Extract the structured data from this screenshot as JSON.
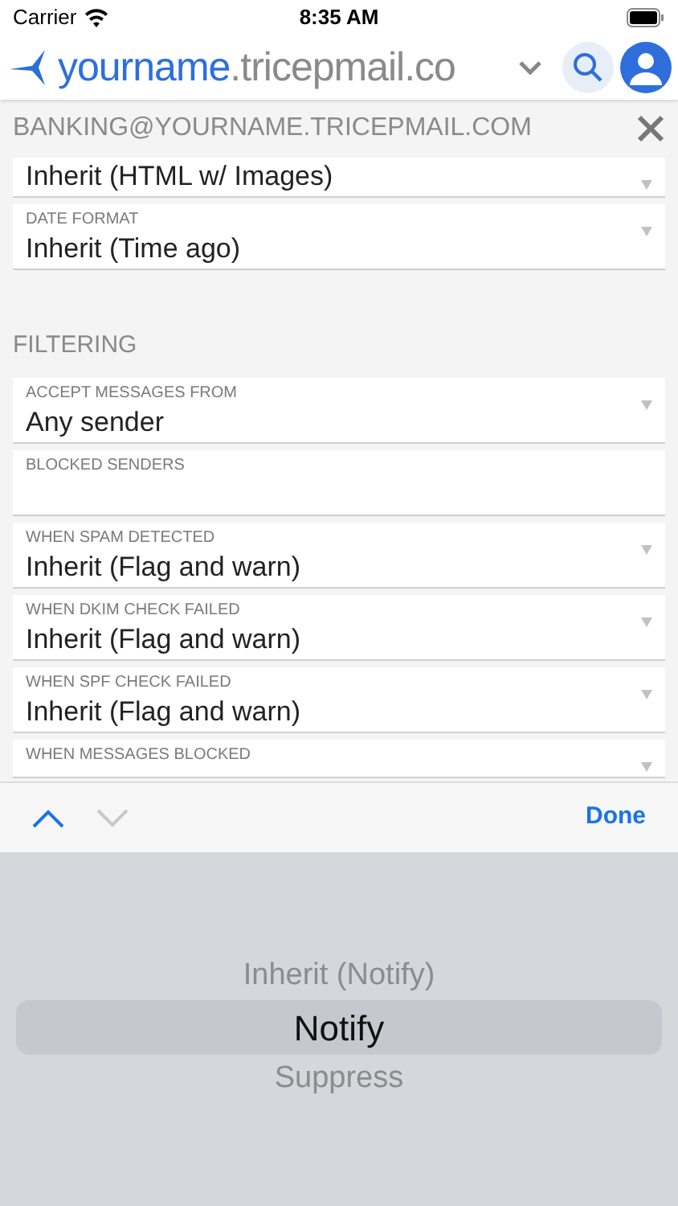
{
  "status_bar": {
    "carrier": "Carrier",
    "time": "8:35 AM"
  },
  "header": {
    "domain_user": "yourname",
    "domain_rest": ".tricepmail.co"
  },
  "account": {
    "title": "BANKING@YOURNAME.TRICEPMAIL.COM"
  },
  "sections": [
    {
      "fields": [
        {
          "kind": "select",
          "value": "Inherit (HTML w/ Images)"
        },
        {
          "kind": "select",
          "label": "DATE FORMAT",
          "value": "Inherit (Time ago)"
        }
      ]
    },
    {
      "title": "FILTERING",
      "fields": [
        {
          "kind": "select",
          "label": "ACCEPT MESSAGES FROM",
          "value": "Any sender"
        },
        {
          "kind": "text",
          "label": "BLOCKED SENDERS"
        },
        {
          "kind": "select",
          "label": "WHEN SPAM DETECTED",
          "value": "Inherit (Flag and warn)"
        },
        {
          "kind": "select",
          "label": "WHEN DKIM CHECK FAILED",
          "value": "Inherit (Flag and warn)"
        },
        {
          "kind": "select",
          "label": "WHEN SPF CHECK FAILED",
          "value": "Inherit (Flag and warn)"
        },
        {
          "kind": "select",
          "label": "WHEN MESSAGES BLOCKED"
        }
      ]
    }
  ],
  "toolbar": {
    "previous_disabled": false,
    "next_disabled": true,
    "done": "Done"
  },
  "picker": [
    {
      "label": "Inherit (Notify)",
      "selected": false
    },
    {
      "label": "Notify",
      "selected": true
    },
    {
      "label": "Suppress",
      "selected": false
    }
  ]
}
